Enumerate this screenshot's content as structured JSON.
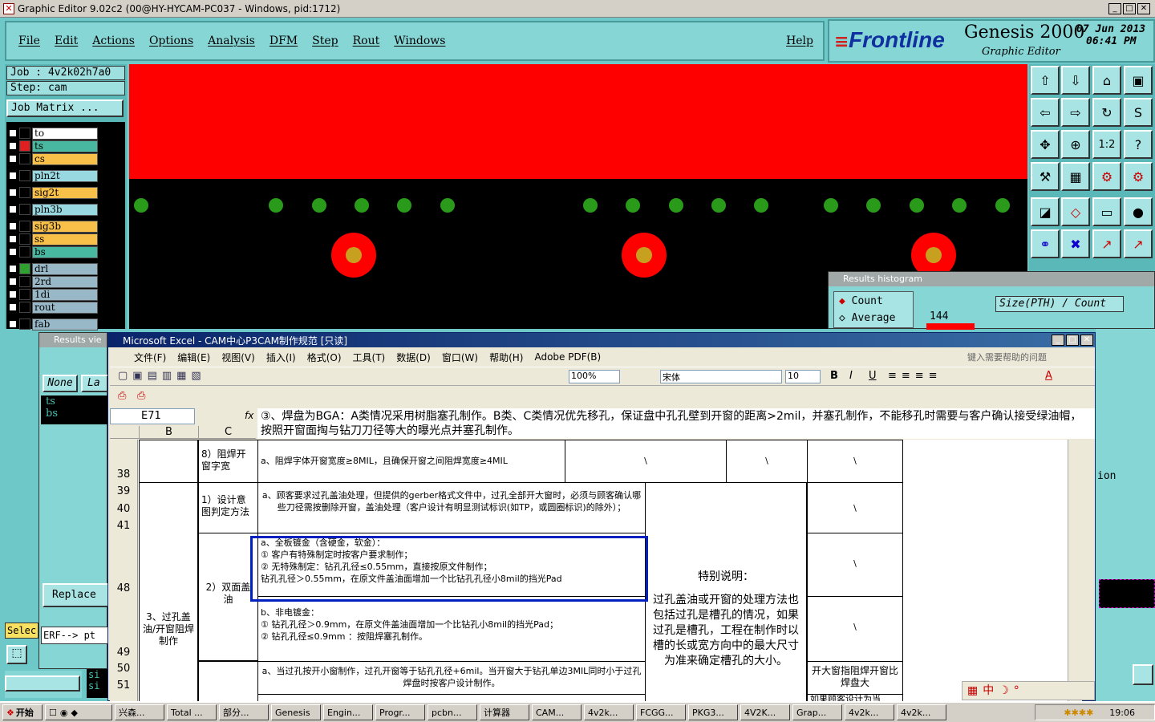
{
  "window": {
    "title": "Graphic Editor 9.02c2 (00@HY-HYCAM-PC037 - Windows, pid:1712)"
  },
  "menu": [
    "File",
    "Edit",
    "Actions",
    "Options",
    "Analysis",
    "DFM",
    "Step",
    "Rout",
    "Windows"
  ],
  "help": "Help",
  "logo": {
    "brand": "Frontline",
    "product": "Genesis 2000",
    "subtitle": "Graphic Editor",
    "date": "07 Jun 2013",
    "time": "06:41 PM"
  },
  "job": {
    "job": "Job : 4v2k02h7a0",
    "step": "Step: cam",
    "matrix": "Job Matrix ..."
  },
  "layers": [
    {
      "name": "to",
      "color": "#000000",
      "bg": "#ffffff"
    },
    {
      "name": "ts",
      "color": "#e02020",
      "bg": "#48b8a0"
    },
    {
      "name": "cs",
      "color": "#000000",
      "bg": "#f8c048"
    },
    {
      "name": "pln2t",
      "color": "#000000",
      "bg": "#98d8e0"
    },
    {
      "name": "sig2t",
      "color": "#000000",
      "bg": "#f8c048"
    },
    {
      "name": "pln3b",
      "color": "#000000",
      "bg": "#98d8e0"
    },
    {
      "name": "sig3b",
      "color": "#000000",
      "bg": "#f8c048"
    },
    {
      "name": "ss",
      "color": "#000000",
      "bg": "#f8c048"
    },
    {
      "name": "bs",
      "color": "#000000",
      "bg": "#48b8a0"
    },
    {
      "name": "drl",
      "color": "#30a030",
      "bg": "#98b8c8"
    },
    {
      "name": "2rd",
      "color": "#000000",
      "bg": "#98b8c8"
    },
    {
      "name": "1di",
      "color": "#000000",
      "bg": "#98b8c8"
    },
    {
      "name": "rout",
      "color": "#000000",
      "bg": "#98b8c8"
    },
    {
      "name": "fab",
      "color": "#000000",
      "bg": "#98b8c8"
    }
  ],
  "results_viewer": {
    "title": "Results vie",
    "none": "None",
    "la": "La",
    "items": [
      "ts",
      "bs"
    ],
    "replace": "Replace",
    "erf": "ERF--> pt",
    "select": "Selec",
    "si1": "si",
    "si2": "si"
  },
  "histogram": {
    "title": "Results histogram",
    "count": "Count",
    "average": "Average",
    "size_label": "Size(PTH) / Count",
    "bar_value": "144",
    "ion": "ion"
  },
  "excel": {
    "title": "Microsoft Excel - CAM中心P3CAM制作规范 [只读]",
    "menu": [
      "文件(F)",
      "编辑(E)",
      "视图(V)",
      "插入(I)",
      "格式(O)",
      "工具(T)",
      "数据(D)",
      "窗口(W)",
      "帮助(H)",
      "Adobe PDF(B)"
    ],
    "help_placeholder": "键入需要帮助的问题",
    "font": "宋体",
    "size": "10",
    "zoom": "100%",
    "namebox": "E71",
    "fx": "fx",
    "formula": "③、焊盘为BGA：A类情况采用树脂塞孔制作。B类、C类情况优先移孔，保证盘中孔孔壁到开窗的距离>2mil，并塞孔制作，不能移孔时需要与客户确认接受绿油帽，按照开窗面掏与钻刀刀径等大的曝光点并塞孔制作。",
    "col_b": "B",
    "col_c": "C",
    "rows": [
      "38",
      "39",
      "40",
      "41",
      "48",
      "49",
      "50",
      "51"
    ],
    "c38": "8）阻焊开窗字宽",
    "d38": "a、阻焊字体开窗宽度≥8MIL，且确保开窗之间阻焊宽度≥4MIL",
    "bs": "\\",
    "c39": "1）设计意图判定方法",
    "d39": "a、顾客要求过孔盖油处理，但提供的gerber格式文件中，过孔全部开大窗时，必须与顾客确认哪些刀径需按删除开窗，盖油处理（客户设计有明显测试标识(如TP，或圆圈标识)的除外）；",
    "b48": "3、过孔盖油/开窗阻焊制作",
    "c48": "2）双面盖油",
    "d48": [
      "a、全板镀金（含硬金，软金）：",
      "① 客户有特殊制定时按客户要求制作；",
      "② 无特殊制定：钻孔孔径≤0.55mm，直接按原文件制作；",
      "   钻孔孔径＞0.55mm，在原文件盖油面增加一个比钻孔孔径小8mil的挡光Pad"
    ],
    "d49": [
      "b、非电镀金：",
      "① 钻孔孔径＞0.9mm，在原文件盖油面增加一个比钻孔小8mil的挡光Pad；",
      "② 钻孔孔径≤0.9mm ：按阻焊塞孔制作。"
    ],
    "e_special_title": "特别说明：",
    "e_special": "过孔盖油或开窗的处理方法也包括过孔是槽孔的情况，如果过孔是槽孔，工程在制作时以槽的长或宽方向中的最大尺寸为准来确定槽孔的大小。",
    "d50": "a、当过孔按开小窗制作，过孔开窗等于钻孔孔径+6mil。当开窗大于钻孔单边3MIL同时小于过孔焊盘时按客户设计制作。",
    "f50": "开大窗指阻焊开窗比焊盘大",
    "f51": "如果顾客设计为当"
  },
  "taskbar": {
    "start": "开始",
    "tasks": [
      "兴森...",
      "Total ...",
      "部分...",
      "Genesis",
      "Engin...",
      "Progr...",
      "pcbn...",
      "计算器",
      "CAM...",
      "4v2k...",
      "FCGG...",
      "PKG3...",
      "4V2K...",
      "Grap...",
      "4v2k...",
      "4v2k..."
    ],
    "clock": "19:06"
  }
}
